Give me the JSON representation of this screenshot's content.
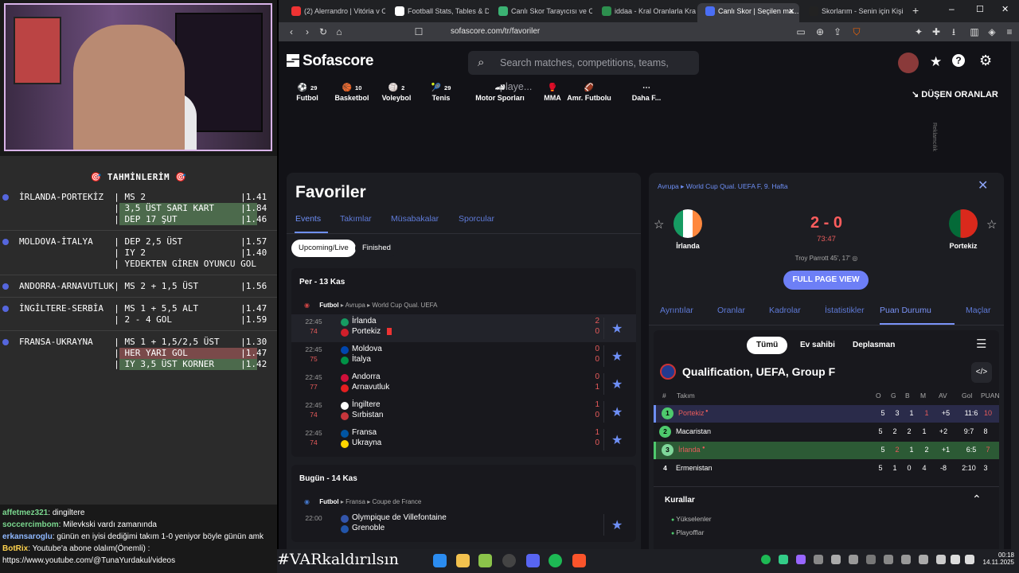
{
  "stream": {
    "predictions_title": "TAHMİNLERİM",
    "bets": [
      {
        "rows": [
          {
            "text": "İRLANDA-PORTEKİZ  | MS 2                  |1.41",
            "hl": ""
          },
          {
            "text": "                  | 3,5 ÜST SARI KART     |1.84",
            "hl": "g"
          },
          {
            "text": "                  | DEP 17 ŞUT            |1.46",
            "hl": "g"
          }
        ]
      },
      {
        "rows": [
          {
            "text": "MOLDOVA-İTALYA    | DEP 2,5 ÜST           |1.57",
            "hl": ""
          },
          {
            "text": "                  | IY 2                  |1.40",
            "hl": ""
          },
          {
            "text": "                  | YEDEKTEN GİREN OYUNCU GOL",
            "hl": ""
          }
        ]
      },
      {
        "rows": [
          {
            "text": "ANDORRA-ARNAVUTLUK| MS 2 + 1,5 ÜST        |1.56",
            "hl": ""
          }
        ]
      },
      {
        "rows": [
          {
            "text": "İNGİLTERE-SERBİA  | MS 1 + 5,5 ALT        |1.47",
            "hl": ""
          },
          {
            "text": "                  | 2 - 4 GOL             |1.59",
            "hl": ""
          }
        ]
      },
      {
        "rows": [
          {
            "text": "FRANSA-UKRAYNA    | MS 1 + 1,5/2,5 ÜST    |1.30",
            "hl": ""
          },
          {
            "text": "                  | HER YARI GOL          |1.47",
            "hl": "r"
          },
          {
            "text": "                  | IY 3,5 ÜST KORNER     |1.42",
            "hl": "g"
          }
        ]
      }
    ],
    "chat": [
      {
        "user": "affetmez321",
        "msg": ": dingiltere"
      },
      {
        "user": "soccercimbom",
        "msg": ": Milevkski vardı zamanında"
      },
      {
        "user": "erkansaroglu",
        "msg": ": günün en iyisi dediğimi takım 1-0 yeniyor böyle günün amk"
      },
      {
        "user": "BotRix",
        "msg": ": Youtube'a abone olalım(Önemli) :"
      },
      {
        "user": "",
        "msg": "https://www.youtube.com/@TunaYurdakul/videos"
      }
    ]
  },
  "browser": {
    "tabs": [
      {
        "title": "(2) Alerrandro | Vitória v Cr...",
        "color": "#e33"
      },
      {
        "title": "Football Stats, Tables & Dat...",
        "color": "#fff"
      },
      {
        "title": "Canlı Skor Tarayıcısı ve Canlı...",
        "color": "#3bb273"
      },
      {
        "title": "iddaa - Kral Oranlarla Kralla...",
        "color": "#2d8f4e"
      },
      {
        "title": "Canlı Skor | Seçilen ma...",
        "color": "#4a6ef5"
      },
      {
        "title": "Skorlarım - Senin için Kişisel...",
        "color": "#222"
      }
    ],
    "url": "sofascore.com/tr/favoriler"
  },
  "site": {
    "logo": "Sofascore",
    "search_placeholder": "Search matches, competitions, teams, playe...",
    "sports": [
      {
        "label": "Futbol",
        "count": "29"
      },
      {
        "label": "Basketbol",
        "count": "10"
      },
      {
        "label": "Voleybol",
        "count": "2"
      },
      {
        "label": "Tenis",
        "count": "29"
      },
      {
        "label": "Motor Sporları",
        "count": ""
      },
      {
        "label": "MMA",
        "count": ""
      },
      {
        "label": "Amr. Futbolu",
        "count": ""
      },
      {
        "label": "Daha F...",
        "count": ""
      }
    ],
    "dropping_odds": "DÜŞEN ORANLAR",
    "ad_label": "Reklamcılık"
  },
  "favorites": {
    "title": "Favoriler",
    "tabs": [
      "Events",
      "Takımlar",
      "Müsabakalar",
      "Sporcular"
    ],
    "filters": [
      "Upcoming/Live",
      "Finished"
    ],
    "days": [
      {
        "label": "Per - 13 Kas",
        "sport": "Futbol",
        "path": "Avrupa ▸ World Cup Qual. UEFA",
        "matches": [
          {
            "time": "22:45",
            "minute": "74",
            "home": "İrlanda",
            "away": "Portekiz",
            "hs": "2",
            "as": "0",
            "hc": "#169b62",
            "ac": "#d11f2b"
          },
          {
            "time": "22:45",
            "minute": "75",
            "home": "Moldova",
            "away": "İtalya",
            "hs": "0",
            "as": "0",
            "hc": "#0046ae",
            "ac": "#009246"
          },
          {
            "time": "22:45",
            "minute": "77",
            "home": "Andorra",
            "away": "Arnavutluk",
            "hs": "0",
            "as": "1",
            "hc": "#d0103a",
            "ac": "#e41e20"
          },
          {
            "time": "22:45",
            "minute": "74",
            "home": "İngiltere",
            "away": "Sırbistan",
            "hs": "1",
            "as": "0",
            "hc": "#ffffff",
            "ac": "#c6363c"
          },
          {
            "time": "22:45",
            "minute": "74",
            "home": "Fransa",
            "away": "Ukrayna",
            "hs": "1",
            "as": "0",
            "hc": "#0055a4",
            "ac": "#ffd500"
          }
        ]
      },
      {
        "label": "Bugün - 14 Kas",
        "sport": "Futbol",
        "path": "Fransa ▸ Coupe de France",
        "matches": [
          {
            "time": "22:00",
            "minute": "",
            "home": "Olympique de Villefontaine",
            "away": "Grenoble",
            "hs": "",
            "as": "",
            "hc": "#3355aa",
            "ac": "#2255aa"
          }
        ]
      }
    ]
  },
  "detail": {
    "breadcrumb": "Avrupa ▸ World Cup Qual. UEFA F, 9. Hafta",
    "home": "İrlanda",
    "away": "Portekiz",
    "score": "2 - 0",
    "clock": "73:47",
    "scorer": "Troy Parrott 45', 17'",
    "full_page": "FULL PAGE VIEW",
    "tabs": [
      "Ayrıntılar",
      "Oranlar",
      "Kadrolar",
      "İstatistikler",
      "Puan Durumu",
      "Maçlar"
    ],
    "stand_filters": [
      "Tümü",
      "Ev sahibi",
      "Deplasman"
    ],
    "group": "Qualification, UEFA, Group F",
    "columns": [
      "#",
      "Takım",
      "O",
      "G",
      "B",
      "M",
      "AV",
      "Gol",
      "PUAN"
    ],
    "rows": [
      {
        "pos": "1",
        "team": "Portekiz",
        "o": "5",
        "g": "3",
        "b": "1",
        "m": "1",
        "av": "+5",
        "gol": "11:6",
        "p": "10",
        "live": true,
        "color": "#4ec96d"
      },
      {
        "pos": "2",
        "team": "Macaristan",
        "o": "5",
        "g": "2",
        "b": "2",
        "m": "1",
        "av": "+2",
        "gol": "9:7",
        "p": "8",
        "live": false,
        "color": "#4ec96d"
      },
      {
        "pos": "3",
        "team": "İrlanda",
        "o": "5",
        "g": "2",
        "b": "1",
        "m": "2",
        "av": "+1",
        "gol": "6:5",
        "p": "7",
        "live": true,
        "color": "#7fd69a"
      },
      {
        "pos": "4",
        "team": "Ermenistan",
        "o": "5",
        "g": "1",
        "b": "0",
        "m": "4",
        "av": "-8",
        "gol": "2:10",
        "p": "3",
        "live": false,
        "color": ""
      }
    ],
    "rules_title": "Kurallar",
    "rules": [
      "Yükselenler",
      "Playofflar"
    ]
  },
  "taskbar": {
    "hashtag": "#VARkaldırılsın",
    "time": "00:18",
    "date": "14.11.2025"
  }
}
